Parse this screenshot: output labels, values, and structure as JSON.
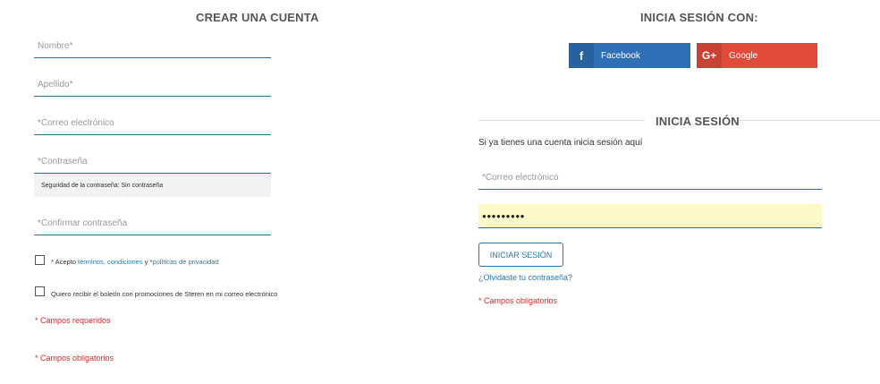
{
  "register": {
    "title": "CREAR UNA CUENTA",
    "first_name_placeholder": "Nombre*",
    "last_name_placeholder": "Apellido*",
    "email_placeholder": "*Correo electrónico",
    "password_placeholder": "*Contraseña",
    "strength_text": "Seguridad de la contraseña: Sin contraseña",
    "confirm_placeholder": "*Confirmar contraseña",
    "terms_prefix": "* Acepto ",
    "terms_link": "términos, condiciones",
    "terms_mid": " y *",
    "privacy_link": "políticas de privacidad",
    "newsletter_text": "Quiero recibir el boletín con promociones de Steren en mi correo electrónico",
    "required_note": "* Campos requeridos",
    "mandatory_note": "* Campos obligatorios"
  },
  "social": {
    "title": "INICIA SESIÓN CON:",
    "facebook_label": "Facebook",
    "facebook_icon": "f",
    "facebook_color": "#2f6fb5",
    "google_label": "Google",
    "google_icon": "G+",
    "google_color": "#e04b3a"
  },
  "login": {
    "title": "INICIA SESIÓN",
    "subtitle": "Si ya tienes una cuenta inicia sesión aquí",
    "email_placeholder": "*Correo electrónico",
    "password_value": "●●●●●●●●●",
    "button_label": "INICIAR SESIÓN",
    "forgot_link": "¿Olvidaste tu contraseña?",
    "mandatory_note": "* Campos obligatorios"
  }
}
